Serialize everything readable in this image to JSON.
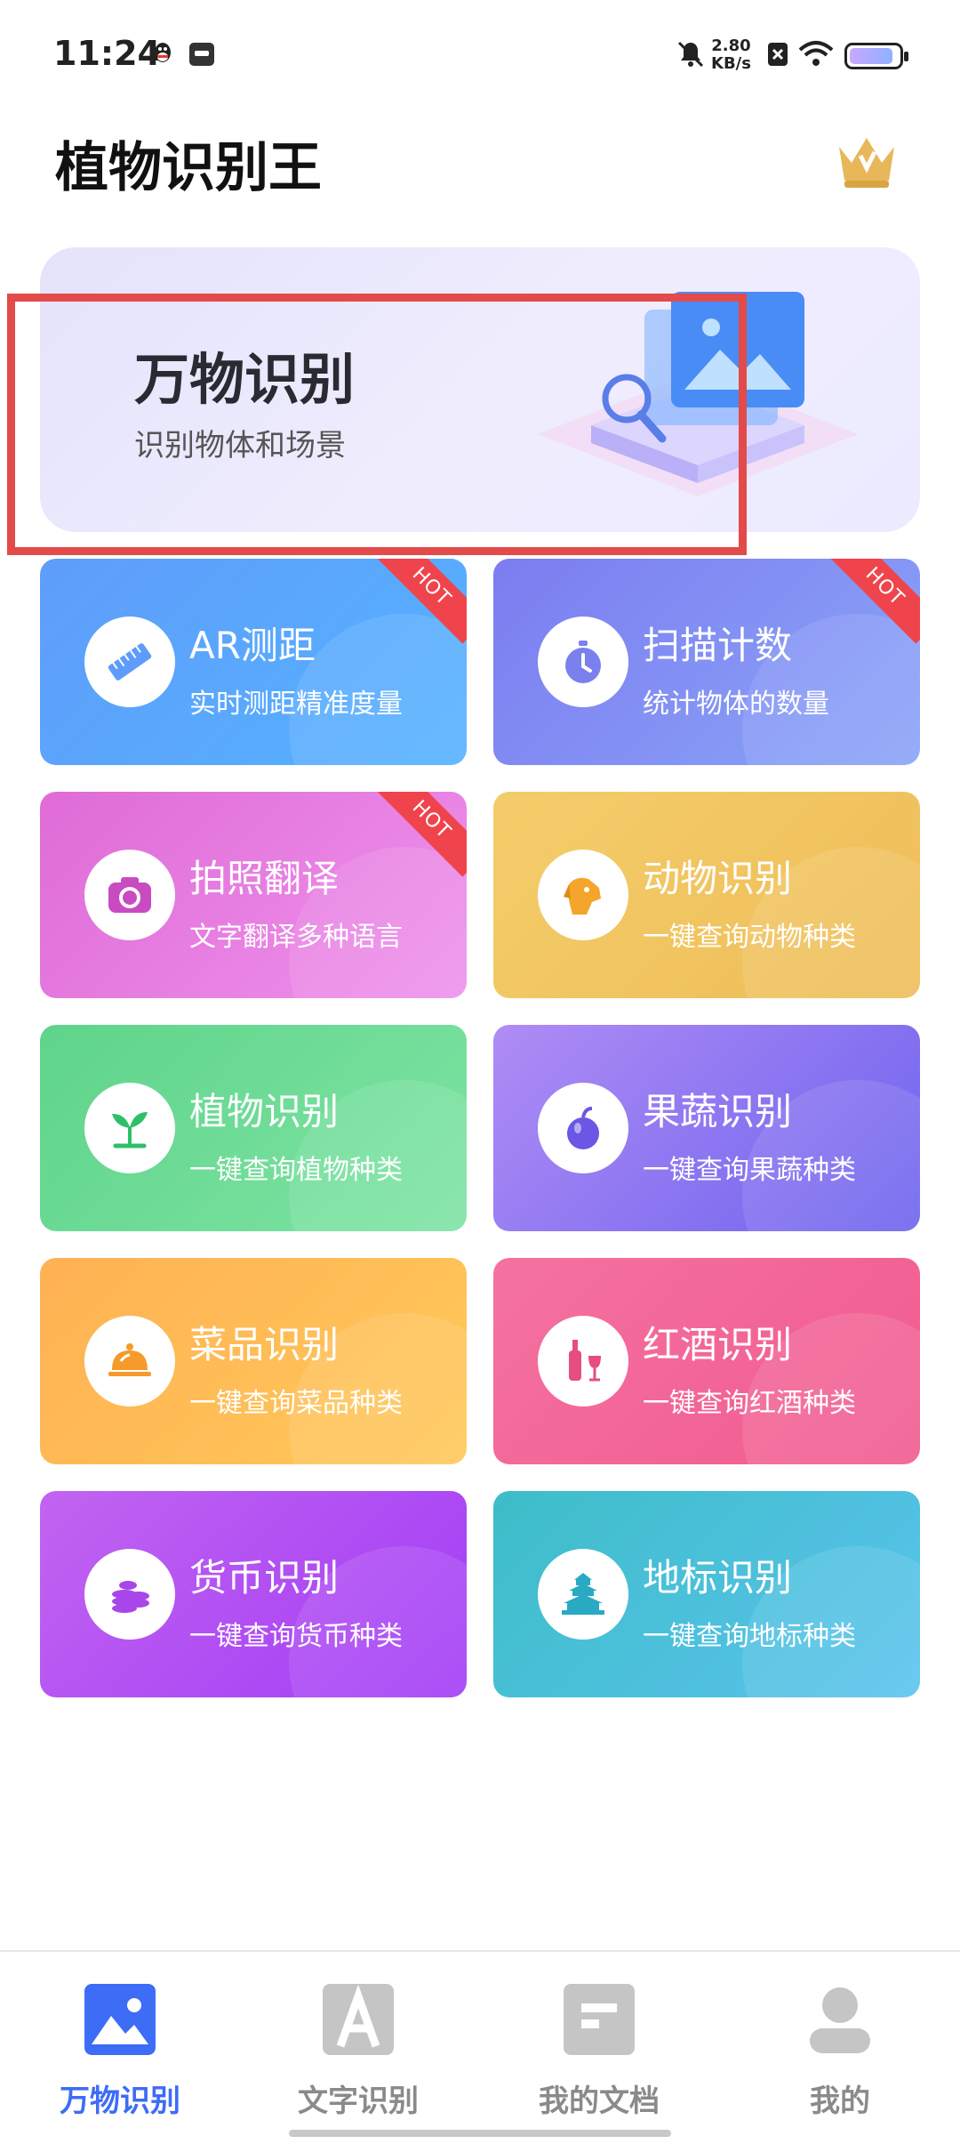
{
  "status": {
    "time": "11:24",
    "net_speed_value": "2.80",
    "net_speed_unit": "KB/s",
    "icons": [
      "qq-icon",
      "calendar-icon",
      "mute-icon",
      "netspeed",
      "sim-x-icon",
      "wifi-icon",
      "battery-icon"
    ]
  },
  "app": {
    "title": "植物识别王",
    "vip_icon": "crown-icon"
  },
  "hero": {
    "title": "万物识别",
    "subtitle": "识别物体和场景"
  },
  "cards": [
    {
      "title": "AR测距",
      "subtitle": "实时测距精准度量",
      "icon": "ruler-icon",
      "hot": "HOT"
    },
    {
      "title": "扫描计数",
      "subtitle": "统计物体的数量",
      "icon": "stopwatch-icon",
      "hot": "HOT"
    },
    {
      "title": "拍照翻译",
      "subtitle": "文字翻译多种语言",
      "icon": "camera-icon",
      "hot": "HOT"
    },
    {
      "title": "动物识别",
      "subtitle": "一键查询动物种类",
      "icon": "dog-icon"
    },
    {
      "title": "植物识别",
      "subtitle": "一键查询植物种类",
      "icon": "sprout-icon"
    },
    {
      "title": "果蔬识别",
      "subtitle": "一键查询果蔬种类",
      "icon": "apple-icon"
    },
    {
      "title": "菜品识别",
      "subtitle": "一键查询菜品种类",
      "icon": "dish-cloche-icon"
    },
    {
      "title": "红酒识别",
      "subtitle": "一键查询红酒种类",
      "icon": "wine-icon"
    },
    {
      "title": "货币识别",
      "subtitle": "一键查询货币种类",
      "icon": "coins-icon"
    },
    {
      "title": "地标识别",
      "subtitle": "一键查询地标种类",
      "icon": "temple-icon"
    }
  ],
  "nav": [
    {
      "label": "万物识别",
      "icon": "image-icon",
      "active": true
    },
    {
      "label": "文字识别",
      "icon": "text-a-icon"
    },
    {
      "label": "我的文档",
      "icon": "document-icon"
    },
    {
      "label": "我的",
      "icon": "person-icon"
    }
  ],
  "colors": {
    "accent": "#3d6cf7",
    "highlight_border": "#e34b4b",
    "hot_ribbon": "#f0444d"
  }
}
